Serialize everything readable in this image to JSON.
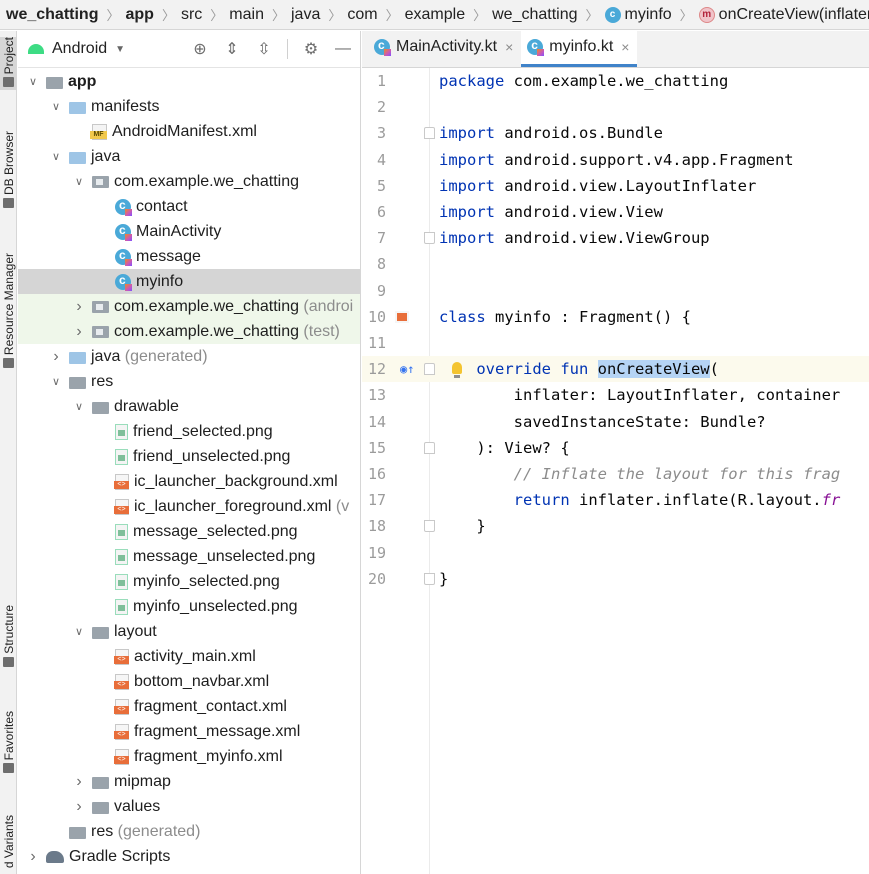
{
  "breadcrumb": [
    {
      "label": "we_chatting",
      "bold": true,
      "icon": ""
    },
    {
      "label": "app",
      "bold": true,
      "icon": ""
    },
    {
      "label": "src",
      "bold": false,
      "icon": ""
    },
    {
      "label": "main",
      "bold": false,
      "icon": ""
    },
    {
      "label": "java",
      "bold": false,
      "icon": ""
    },
    {
      "label": "com",
      "bold": false,
      "icon": ""
    },
    {
      "label": "example",
      "bold": false,
      "icon": ""
    },
    {
      "label": "we_chatting",
      "bold": false,
      "icon": ""
    },
    {
      "label": "myinfo",
      "bold": false,
      "icon": "kotlin-class-icon"
    },
    {
      "label": "onCreateView(inflater: Layout",
      "bold": false,
      "icon": "method-icon"
    }
  ],
  "side_tabs": [
    {
      "label": "Project",
      "active": true
    },
    {
      "label": "DB Browser",
      "active": false
    },
    {
      "label": "Resource Manager",
      "active": false
    },
    {
      "label": "Structure",
      "active": false
    },
    {
      "label": "Favorites",
      "active": false
    },
    {
      "label": "d Variants",
      "active": false
    }
  ],
  "project_panel": {
    "view_label": "Android",
    "toolbar_icons": [
      "locate-icon",
      "expand-all-icon",
      "collapse-all-icon",
      "settings-gear-icon",
      "hide-minus-icon"
    ]
  },
  "tree": [
    {
      "depth": 0,
      "arrow": "down",
      "icon": "module",
      "label": "app",
      "suffix": "",
      "bold": true,
      "state": ""
    },
    {
      "depth": 1,
      "arrow": "down",
      "icon": "folder",
      "label": "manifests",
      "suffix": "",
      "bold": false,
      "state": ""
    },
    {
      "depth": 2,
      "arrow": "none",
      "icon": "manifest",
      "label": "AndroidManifest.xml",
      "suffix": "",
      "bold": false,
      "state": ""
    },
    {
      "depth": 1,
      "arrow": "down",
      "icon": "folder",
      "label": "java",
      "suffix": "",
      "bold": false,
      "state": ""
    },
    {
      "depth": 2,
      "arrow": "down",
      "icon": "package",
      "label": "com.example.we_chatting",
      "suffix": "",
      "bold": false,
      "state": ""
    },
    {
      "depth": 3,
      "arrow": "none",
      "icon": "kclass",
      "label": "contact",
      "suffix": "",
      "bold": false,
      "state": ""
    },
    {
      "depth": 3,
      "arrow": "none",
      "icon": "kclass",
      "label": "MainActivity",
      "suffix": "",
      "bold": false,
      "state": ""
    },
    {
      "depth": 3,
      "arrow": "none",
      "icon": "kclass",
      "label": "message",
      "suffix": "",
      "bold": false,
      "state": ""
    },
    {
      "depth": 3,
      "arrow": "none",
      "icon": "kclass",
      "label": "myinfo",
      "suffix": "",
      "bold": false,
      "state": "selected"
    },
    {
      "depth": 2,
      "arrow": "right",
      "icon": "package",
      "label": "com.example.we_chatting",
      "suffix": " (androi",
      "bold": false,
      "state": "tinted"
    },
    {
      "depth": 2,
      "arrow": "right",
      "icon": "package",
      "label": "com.example.we_chatting",
      "suffix": " (test)",
      "bold": false,
      "state": "tinted"
    },
    {
      "depth": 1,
      "arrow": "right",
      "icon": "folder-gen",
      "label": "java",
      "suffix": " (generated)",
      "bold": false,
      "state": ""
    },
    {
      "depth": 1,
      "arrow": "down",
      "icon": "folder-res",
      "label": "res",
      "suffix": "",
      "bold": false,
      "state": ""
    },
    {
      "depth": 2,
      "arrow": "down",
      "icon": "folder-gray",
      "label": "drawable",
      "suffix": "",
      "bold": false,
      "state": ""
    },
    {
      "depth": 3,
      "arrow": "none",
      "icon": "png",
      "label": "friend_selected.png",
      "suffix": "",
      "bold": false,
      "state": ""
    },
    {
      "depth": 3,
      "arrow": "none",
      "icon": "png",
      "label": "friend_unselected.png",
      "suffix": "",
      "bold": false,
      "state": ""
    },
    {
      "depth": 3,
      "arrow": "none",
      "icon": "xml",
      "label": "ic_launcher_background.xml",
      "suffix": "",
      "bold": false,
      "state": ""
    },
    {
      "depth": 3,
      "arrow": "none",
      "icon": "xml",
      "label": "ic_launcher_foreground.xml",
      "suffix": " (v",
      "bold": false,
      "state": ""
    },
    {
      "depth": 3,
      "arrow": "none",
      "icon": "png",
      "label": "message_selected.png",
      "suffix": "",
      "bold": false,
      "state": ""
    },
    {
      "depth": 3,
      "arrow": "none",
      "icon": "png",
      "label": "message_unselected.png",
      "suffix": "",
      "bold": false,
      "state": ""
    },
    {
      "depth": 3,
      "arrow": "none",
      "icon": "png",
      "label": "myinfo_selected.png",
      "suffix": "",
      "bold": false,
      "state": ""
    },
    {
      "depth": 3,
      "arrow": "none",
      "icon": "png",
      "label": "myinfo_unselected.png",
      "suffix": "",
      "bold": false,
      "state": ""
    },
    {
      "depth": 2,
      "arrow": "down",
      "icon": "folder-gray",
      "label": "layout",
      "suffix": "",
      "bold": false,
      "state": ""
    },
    {
      "depth": 3,
      "arrow": "none",
      "icon": "xml",
      "label": "activity_main.xml",
      "suffix": "",
      "bold": false,
      "state": ""
    },
    {
      "depth": 3,
      "arrow": "none",
      "icon": "xml",
      "label": "bottom_navbar.xml",
      "suffix": "",
      "bold": false,
      "state": ""
    },
    {
      "depth": 3,
      "arrow": "none",
      "icon": "xml",
      "label": "fragment_contact.xml",
      "suffix": "",
      "bold": false,
      "state": ""
    },
    {
      "depth": 3,
      "arrow": "none",
      "icon": "xml",
      "label": "fragment_message.xml",
      "suffix": "",
      "bold": false,
      "state": ""
    },
    {
      "depth": 3,
      "arrow": "none",
      "icon": "xml",
      "label": "fragment_myinfo.xml",
      "suffix": "",
      "bold": false,
      "state": ""
    },
    {
      "depth": 2,
      "arrow": "right",
      "icon": "folder-gray",
      "label": "mipmap",
      "suffix": "",
      "bold": false,
      "state": ""
    },
    {
      "depth": 2,
      "arrow": "right",
      "icon": "folder-gray",
      "label": "values",
      "suffix": "",
      "bold": false,
      "state": ""
    },
    {
      "depth": 1,
      "arrow": "none",
      "icon": "folder-res",
      "label": "res",
      "suffix": " (generated)",
      "bold": false,
      "state": ""
    },
    {
      "depth": 0,
      "arrow": "right",
      "icon": "gradle",
      "label": "Gradle Scripts",
      "suffix": "",
      "bold": false,
      "state": ""
    }
  ],
  "editor": {
    "tabs": [
      {
        "label": "MainActivity.kt",
        "active": false
      },
      {
        "label": "myinfo.kt",
        "active": true
      }
    ],
    "close_glyph": "×",
    "current_line": 12,
    "lines": [
      {
        "n": "1",
        "tokens": [
          {
            "t": "package ",
            "c": "kw"
          },
          {
            "t": "com.example.we_chatting",
            "c": ""
          }
        ]
      },
      {
        "n": "2",
        "tokens": []
      },
      {
        "n": "3",
        "fold": "start",
        "tokens": [
          {
            "t": "import ",
            "c": "kw"
          },
          {
            "t": "android.os.Bundle",
            "c": ""
          }
        ]
      },
      {
        "n": "4",
        "tokens": [
          {
            "t": "import ",
            "c": "kw"
          },
          {
            "t": "android.support.v4.app.Fragment",
            "c": ""
          }
        ]
      },
      {
        "n": "5",
        "tokens": [
          {
            "t": "import ",
            "c": "kw"
          },
          {
            "t": "android.view.LayoutInflater",
            "c": ""
          }
        ]
      },
      {
        "n": "6",
        "tokens": [
          {
            "t": "import ",
            "c": "kw"
          },
          {
            "t": "android.view.View",
            "c": ""
          }
        ]
      },
      {
        "n": "7",
        "fold": "end",
        "tokens": [
          {
            "t": "import ",
            "c": "kw"
          },
          {
            "t": "android.view.ViewGroup",
            "c": ""
          }
        ]
      },
      {
        "n": "8",
        "tokens": []
      },
      {
        "n": "9",
        "tokens": []
      },
      {
        "n": "10",
        "mark": "xml-link",
        "tokens": [
          {
            "t": "class ",
            "c": "kw"
          },
          {
            "t": "myinfo",
            "c": "ul"
          },
          {
            "t": " : Fragment() {",
            "c": ""
          }
        ]
      },
      {
        "n": "11",
        "tokens": []
      },
      {
        "n": "12",
        "mark": "override",
        "fold": "start",
        "bulb": true,
        "tokens": [
          {
            "t": "    override fun ",
            "c": "kw"
          },
          {
            "t": "onCreateView",
            "c": "hl"
          },
          {
            "t": "(",
            "c": ""
          }
        ]
      },
      {
        "n": "13",
        "tokens": [
          {
            "t": "        inflater: LayoutInflater, container",
            "c": ""
          }
        ]
      },
      {
        "n": "14",
        "tokens": [
          {
            "t": "        savedInstanceState: Bundle?",
            "c": ""
          }
        ]
      },
      {
        "n": "15",
        "fold": "start",
        "tokens": [
          {
            "t": "    ): View? {",
            "c": ""
          }
        ]
      },
      {
        "n": "16",
        "tokens": [
          {
            "t": "        // Inflate the layout for this frag",
            "c": "cmt"
          }
        ]
      },
      {
        "n": "17",
        "tokens": [
          {
            "t": "        return ",
            "c": "kw"
          },
          {
            "t": "inflater.inflate(R.layout.",
            "c": ""
          },
          {
            "t": "fr",
            "c": "it"
          }
        ]
      },
      {
        "n": "18",
        "fold": "end",
        "tokens": [
          {
            "t": "    }",
            "c": ""
          }
        ]
      },
      {
        "n": "19",
        "tokens": []
      },
      {
        "n": "20",
        "fold": "end",
        "tokens": [
          {
            "t": "}",
            "c": ""
          }
        ]
      }
    ]
  },
  "colors": {
    "keyword": "#0033b3",
    "selection_row": "#d5d5d5",
    "test_row_tint": "#eff7ea",
    "current_line": "#fcfaed",
    "identifier_highlight": "#b5d4f5",
    "active_tab_underline": "#4083c9"
  }
}
